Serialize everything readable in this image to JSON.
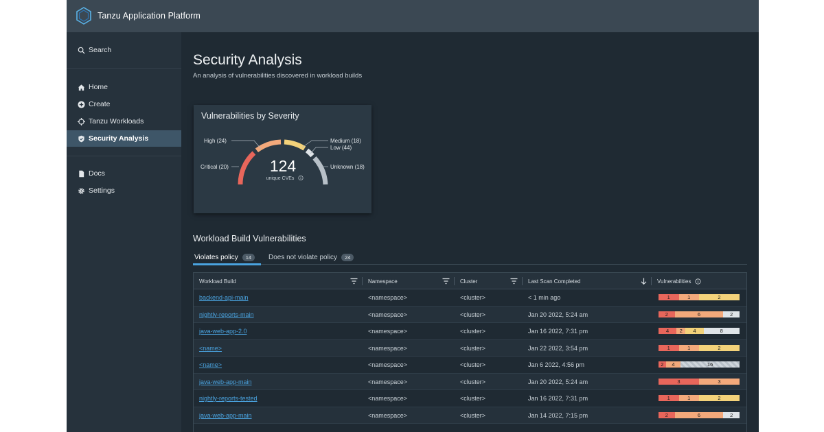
{
  "app": {
    "title": "Tanzu Application Platform"
  },
  "sidebar": {
    "search_label": "Search",
    "items": [
      {
        "label": "Home",
        "icon": "home-icon"
      },
      {
        "label": "Create",
        "icon": "plus-circle-icon"
      },
      {
        "label": "Tanzu Workloads",
        "icon": "crosshair-icon"
      },
      {
        "label": "Security Analysis",
        "icon": "shield-icon",
        "active": true
      },
      {
        "label": "Docs",
        "icon": "document-icon"
      },
      {
        "label": "Settings",
        "icon": "gear-icon"
      }
    ]
  },
  "page": {
    "title": "Security Analysis",
    "subtitle": "An analysis of vulnerabilities discovered in workload builds"
  },
  "severity_card": {
    "title": "Vulnerabilities by Severity",
    "total": "124",
    "total_caption": "unique CVEs",
    "labels": {
      "high": "High (24)",
      "critical": "Critical (20)",
      "medium": "Medium (18)",
      "low": "Low (44)",
      "unknown": "Unknown (18)"
    },
    "colors": {
      "critical": "#e8665b",
      "high": "#f3a97b",
      "medium": "#f3d27a",
      "low": "#dfe4e8",
      "unknown": "#b7c0c8"
    }
  },
  "section": {
    "title": "Workload Build Vulnerabilities"
  },
  "tabs": [
    {
      "label": "Violates policy",
      "count": "14"
    },
    {
      "label": "Does not violate policy",
      "count": "24"
    }
  ],
  "table": {
    "columns": [
      "Workload Build",
      "Namespace",
      "Cluster",
      "Last Scan Completed",
      "Vulnerabilities"
    ],
    "rows": [
      {
        "build": "backend-api-main",
        "namespace": "<namespace>",
        "cluster": "<cluster>",
        "scan": "< 1 min ago",
        "vuln": [
          [
            "crit",
            1
          ],
          [
            "high",
            1
          ],
          [
            "med",
            2
          ]
        ]
      },
      {
        "build": "nightly-reports-main",
        "namespace": "<namespace>",
        "cluster": "<cluster>",
        "scan": "Jan 20 2022, 5:24 am",
        "vuln": [
          [
            "crit",
            2
          ],
          [
            "high",
            6
          ],
          [
            "low",
            2
          ]
        ]
      },
      {
        "build": "java-web-app-2.0",
        "namespace": "<namespace>",
        "cluster": "<cluster>",
        "scan": "Jan 16 2022, 7:31 pm",
        "vuln": [
          [
            "crit",
            4
          ],
          [
            "high",
            2
          ],
          [
            "med",
            4
          ],
          [
            "low",
            8
          ]
        ]
      },
      {
        "build": "<name>",
        "namespace": "<namespace>",
        "cluster": "<cluster>",
        "scan": "Jan 22 2022, 3:54 pm",
        "vuln": [
          [
            "crit",
            1
          ],
          [
            "high",
            1
          ],
          [
            "med",
            2
          ]
        ]
      },
      {
        "build": "<name>",
        "namespace": "<namespace>",
        "cluster": "<cluster>",
        "scan": "Jan 6 2022, 4:56 pm",
        "vuln": [
          [
            "crit",
            2
          ],
          [
            "high",
            4
          ],
          [
            "unk",
            16
          ]
        ]
      },
      {
        "build": "java-web-app-main",
        "namespace": "<namespace>",
        "cluster": "<cluster>",
        "scan": "Jan 20 2022, 5:24 am",
        "vuln": [
          [
            "crit",
            3
          ],
          [
            "high",
            3
          ]
        ]
      },
      {
        "build": "nightly-reports-tested",
        "namespace": "<namespace>",
        "cluster": "<cluster>",
        "scan": "Jan 16 2022, 7:31 pm",
        "vuln": [
          [
            "crit",
            1
          ],
          [
            "high",
            1
          ],
          [
            "med",
            2
          ]
        ]
      },
      {
        "build": "java-web-app-main",
        "namespace": "<namespace>",
        "cluster": "<cluster>",
        "scan": "Jan 14 2022, 7:15 pm",
        "vuln": [
          [
            "crit",
            2
          ],
          [
            "high",
            6
          ],
          [
            "low",
            2
          ]
        ]
      }
    ]
  }
}
